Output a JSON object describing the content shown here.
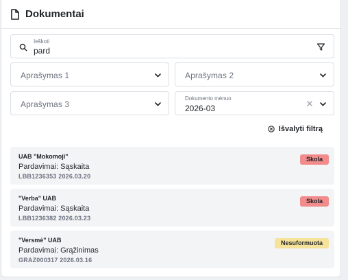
{
  "header": {
    "title": "Dokumentai",
    "icon": "document-icon"
  },
  "search": {
    "label": "Ieškoti",
    "value": "pard",
    "icon": "search-icon",
    "filter_icon": "filter-icon"
  },
  "filters": {
    "description1": {
      "placeholder": "Aprašymas 1"
    },
    "description2": {
      "placeholder": "Aprašymas 2"
    },
    "description3": {
      "placeholder": "Aprašymas 3"
    },
    "month": {
      "label": "Dokumento mėnuo",
      "value": "2026-03"
    }
  },
  "clear_filter": {
    "label": "Išvalyti filtrą"
  },
  "documents": [
    {
      "company": "UAB \"Mokomoji\"",
      "type": "Pardavimai: Sąskaita",
      "meta": "LBB1236353 2026.03.20",
      "status": "Skola",
      "status_color": "#f28b8b"
    },
    {
      "company": "\"Verba\" UAB",
      "type": "Pardavimai: Sąskaita",
      "meta": "LBB1236382 2026.03.23",
      "status": "Skola",
      "status_color": "#f28b8b"
    },
    {
      "company": "\"Versmė\" UAB",
      "type": "Pardavimai: Grąžinimas",
      "meta": "GRAZ000317 2026.03.16",
      "status": "Nesuformuota",
      "status_color": "#f6e39a"
    }
  ]
}
